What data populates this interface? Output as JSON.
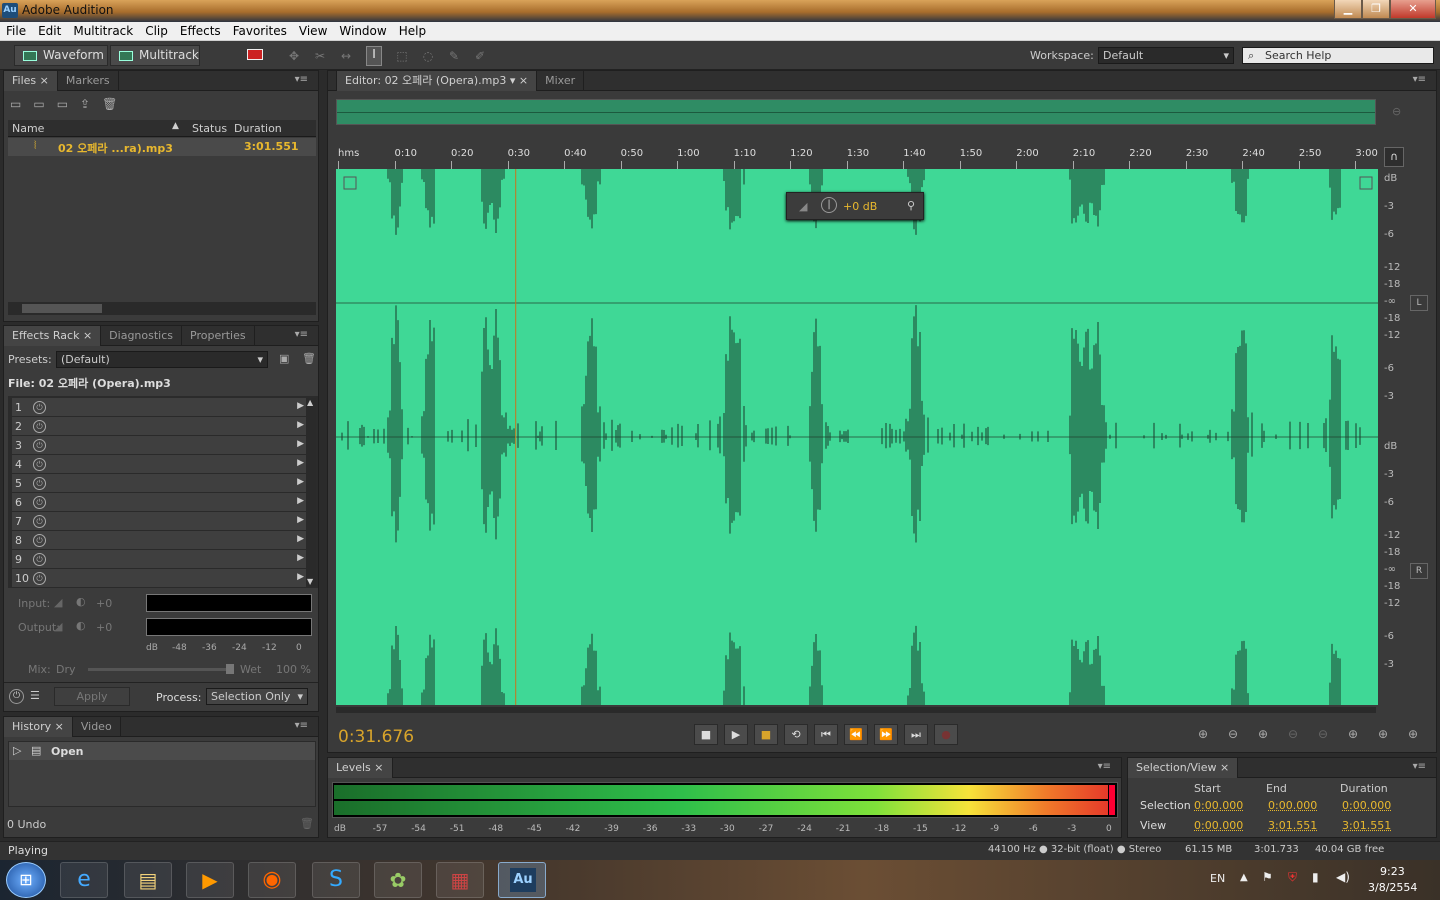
{
  "window": {
    "title": "Adobe Audition",
    "app_badge": "Au"
  },
  "menu": [
    "File",
    "Edit",
    "Multitrack",
    "Clip",
    "Effects",
    "Favorites",
    "View",
    "Window",
    "Help"
  ],
  "toolbar": {
    "waveform_label": "Waveform",
    "multitrack_label": "Multitrack",
    "workspace_label": "Workspace:",
    "workspace_value": "Default",
    "search_placeholder": "Search Help"
  },
  "files_panel": {
    "tabs": [
      "Files",
      "Markers"
    ],
    "columns": {
      "name": "Name",
      "status": "Status",
      "duration": "Duration"
    },
    "file": {
      "name": "02 오페라 ...ra).mp3",
      "duration": "3:01.551"
    }
  },
  "effects_panel": {
    "tabs": [
      "Effects Rack",
      "Diagnostics",
      "Properties"
    ],
    "presets_label": "Presets:",
    "presets_value": "(Default)",
    "file_label": "File: 02 오페라 (Opera).mp3",
    "slots": [
      "1",
      "2",
      "3",
      "4",
      "5",
      "6",
      "7",
      "8",
      "9",
      "10"
    ],
    "input_label": "Input:",
    "output_label": "Output:",
    "gain_value": "+0",
    "meter_scale": [
      "dB",
      "-48",
      "-36",
      "-24",
      "-12",
      "0"
    ],
    "mix_label": "Mix:",
    "dry_label": "Dry",
    "wet_label": "Wet",
    "wet_value": "100 %",
    "apply_label": "Apply",
    "process_label": "Process:",
    "process_value": "Selection Only"
  },
  "history_panel": {
    "tabs": [
      "History",
      "Video"
    ],
    "item": "Open",
    "undo_count": "0 Undo"
  },
  "editor": {
    "tab_label": "Editor: 02 오페라 (Opera).mp3",
    "mixer_tab": "Mixer",
    "time_ticks": [
      "hms",
      "0:10",
      "0:20",
      "0:30",
      "0:40",
      "0:50",
      "1:00",
      "1:10",
      "1:20",
      "1:30",
      "1:40",
      "1:50",
      "2:00",
      "2:10",
      "2:20",
      "2:30",
      "2:40",
      "2:50",
      "3:00"
    ],
    "hud_value": "+0 dB",
    "db_scale_top": [
      "dB",
      "-3",
      "-6",
      "-12",
      "-18",
      "-∞",
      "-18",
      "-12",
      "-6",
      "-3"
    ],
    "db_scale_bottom": [
      "dB",
      "-3",
      "-6",
      "-12",
      "-18",
      "-∞",
      "-18",
      "-12",
      "-6",
      "-3"
    ],
    "channel_left": "L",
    "channel_right": "R",
    "current_time": "0:31.676",
    "waveform_color": "#3fd896",
    "playhead_seconds": 31.676,
    "duration_seconds": 181.551
  },
  "levels_panel": {
    "tab": "Levels",
    "scale": [
      "dB",
      "-57",
      "-54",
      "-51",
      "-48",
      "-45",
      "-42",
      "-39",
      "-36",
      "-33",
      "-30",
      "-27",
      "-24",
      "-21",
      "-18",
      "-15",
      "-12",
      "-9",
      "-6",
      "-3",
      "0"
    ]
  },
  "selection_view": {
    "tab": "Selection/View",
    "headers": {
      "start": "Start",
      "end": "End",
      "duration": "Duration"
    },
    "selection": {
      "label": "Selection",
      "start": "0:00.000",
      "end": "0:00.000",
      "duration": "0:00.000"
    },
    "view": {
      "label": "View",
      "start": "0:00.000",
      "end": "3:01.551",
      "duration": "3:01.551"
    }
  },
  "statusbar": {
    "state": "Playing",
    "format": "44100 Hz ● 32-bit (float) ● Stereo",
    "size": "61.15 MB",
    "length": "3:01.733",
    "free": "40.04 GB free"
  },
  "taskbar": {
    "lang": "EN",
    "time": "9:23",
    "date": "3/8/2554"
  }
}
